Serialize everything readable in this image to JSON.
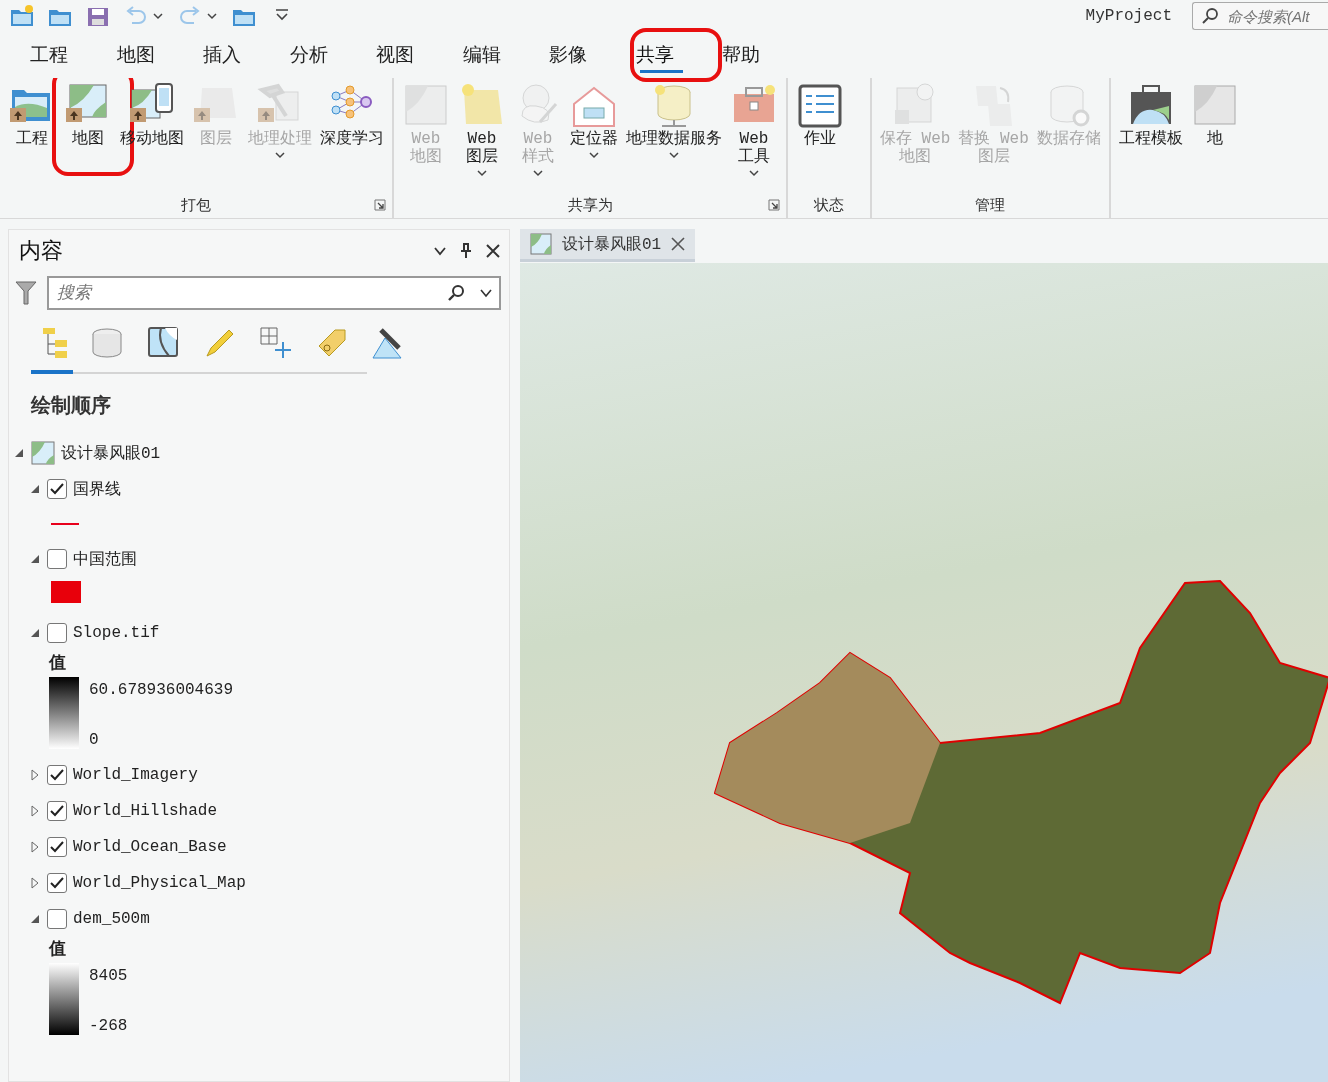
{
  "quick_access": {
    "title": "MyProject",
    "search": {
      "placeholder": "命令搜索(Alt"
    }
  },
  "tabs": [
    {
      "label": "工程",
      "selected": false,
      "highlighted": false
    },
    {
      "label": "地图",
      "selected": false,
      "highlighted": false
    },
    {
      "label": "插入",
      "selected": false,
      "highlighted": false
    },
    {
      "label": "分析",
      "selected": false,
      "highlighted": false
    },
    {
      "label": "视图",
      "selected": false,
      "highlighted": false
    },
    {
      "label": "编辑",
      "selected": false,
      "highlighted": false
    },
    {
      "label": "影像",
      "selected": false,
      "highlighted": false
    },
    {
      "label": "共享",
      "selected": true,
      "highlighted": true
    },
    {
      "label": "帮助",
      "selected": false,
      "highlighted": false
    }
  ],
  "ribbon": {
    "groups": [
      {
        "label": "打包",
        "launcher": true,
        "buttons": [
          {
            "label": "工程",
            "disabled": false,
            "dropdown": false,
            "highlighted": false
          },
          {
            "label": "地图",
            "disabled": false,
            "dropdown": false,
            "highlighted": true
          },
          {
            "label": "移动地图",
            "disabled": false,
            "dropdown": false,
            "highlighted": false
          },
          {
            "label": "图层",
            "disabled": true,
            "dropdown": false,
            "highlighted": false
          },
          {
            "label": "地理处理",
            "disabled": true,
            "dropdown": true,
            "highlighted": false
          },
          {
            "label": "深度学习",
            "disabled": false,
            "dropdown": false,
            "highlighted": false
          }
        ]
      },
      {
        "label": "共享为",
        "launcher": true,
        "buttons": [
          {
            "label": "Web\n地图",
            "disabled": true,
            "dropdown": false,
            "highlighted": false
          },
          {
            "label": "Web\n图层",
            "disabled": false,
            "dropdown": true,
            "highlighted": false
          },
          {
            "label": "Web\n样式",
            "disabled": true,
            "dropdown": true,
            "highlighted": false
          },
          {
            "label": "定位器",
            "disabled": false,
            "dropdown": true,
            "highlighted": false
          },
          {
            "label": "地理数据服务",
            "disabled": false,
            "dropdown": true,
            "highlighted": false
          },
          {
            "label": "Web\n工具",
            "disabled": false,
            "dropdown": true,
            "highlighted": false
          }
        ]
      },
      {
        "label": "状态",
        "buttons": [
          {
            "label": "作业",
            "disabled": false,
            "dropdown": false,
            "highlighted": false
          }
        ]
      },
      {
        "label": "管理",
        "buttons": [
          {
            "label": "保存 Web\n地图",
            "disabled": true,
            "dropdown": false,
            "highlighted": false
          },
          {
            "label": "替换 Web\n图层",
            "disabled": true,
            "dropdown": false,
            "highlighted": false
          },
          {
            "label": "数据存储",
            "disabled": true,
            "dropdown": false,
            "highlighted": false
          }
        ]
      },
      {
        "buttons": [
          {
            "label": "工程模板",
            "disabled": false,
            "dropdown": false,
            "highlighted": false
          },
          {
            "label": "地",
            "disabled": false,
            "dropdown": false,
            "highlighted": false
          }
        ]
      }
    ]
  },
  "contents": {
    "title": "内容",
    "search": {
      "placeholder": "搜索"
    },
    "views": [
      {
        "selected": true
      },
      {
        "selected": false
      },
      {
        "selected": false
      },
      {
        "selected": false
      },
      {
        "selected": false
      },
      {
        "selected": false
      },
      {
        "selected": false
      }
    ],
    "heading": "绘制顺序",
    "tree": [
      {
        "kind": "map",
        "label": "设计暴风眼01",
        "expanded": true,
        "children": [
          {
            "kind": "layer",
            "label": "国界线",
            "checked": true,
            "expanded": true,
            "legend": {
              "kind": "line",
              "color": "#e8001c"
            }
          },
          {
            "kind": "layer",
            "label": "中国范围",
            "checked": false,
            "expanded": true,
            "legend": {
              "kind": "fill",
              "color": "#e8000b"
            }
          },
          {
            "kind": "layer",
            "label": "Slope.tif",
            "checked": false,
            "expanded": true,
            "legend": {
              "kind": "ramp",
              "title": "值",
              "high": "60.678936004639",
              "low": "0",
              "light_high": false
            }
          },
          {
            "kind": "layer",
            "label": "World_Imagery",
            "checked": true,
            "expanded": false
          },
          {
            "kind": "layer",
            "label": "World_Hillshade",
            "checked": true,
            "expanded": false
          },
          {
            "kind": "layer",
            "label": "World_Ocean_Base",
            "checked": true,
            "expanded": false
          },
          {
            "kind": "layer",
            "label": "World_Physical_Map",
            "checked": true,
            "expanded": false
          },
          {
            "kind": "layer",
            "label": "dem_500m",
            "checked": false,
            "expanded": true,
            "legend": {
              "kind": "ramp",
              "title": "值",
              "high": "8405",
              "low": "-268",
              "light_high": true
            }
          }
        ]
      }
    ]
  },
  "map_view": {
    "tabs": [
      {
        "label": "设计暴风眼01",
        "selected": true
      }
    ]
  }
}
